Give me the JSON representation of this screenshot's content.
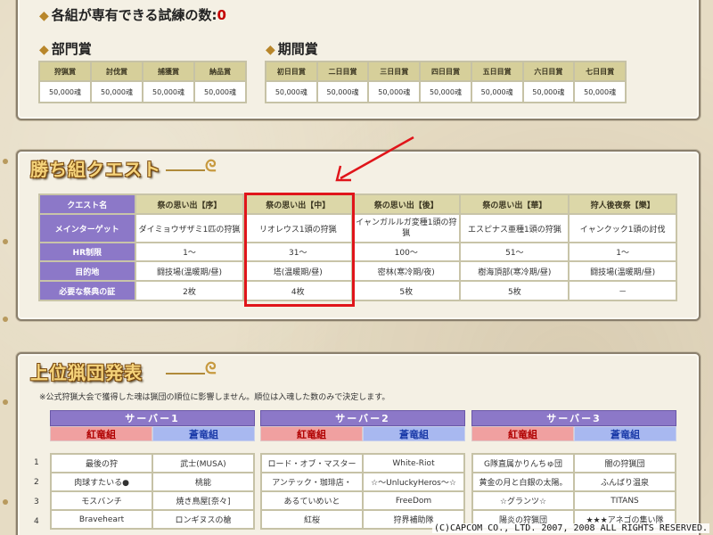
{
  "top": {
    "exclusive_trials_label": "各組が専有できる試練の数:",
    "exclusive_trials_count": "0",
    "dept_prize_title": "部門賞",
    "dept_prize_headers": [
      "狩猟賞",
      "討伐賞",
      "捕獲賞",
      "納品賞"
    ],
    "dept_prize_values": [
      "50,000魂",
      "50,000魂",
      "50,000魂",
      "50,000魂"
    ],
    "period_prize_title": "期間賞",
    "period_prize_headers": [
      "初日目賞",
      "二日目賞",
      "三日目賞",
      "四日目賞",
      "五日目賞",
      "六日目賞",
      "七日目賞"
    ],
    "period_prize_values": [
      "50,000魂",
      "50,000魂",
      "50,000魂",
      "50,000魂",
      "50,000魂",
      "50,000魂",
      "50,000魂"
    ]
  },
  "quest": {
    "banner": "勝ち組クエスト",
    "row_headers": [
      "クエスト名",
      "メインターゲット",
      "HR制限",
      "目的地",
      "必要な祭典の証"
    ],
    "columns": [
      {
        "name": "祭の思い出【序】",
        "target": "ダイミョウザザミ1匹の狩猟",
        "hr": "1～",
        "dest": "闘技場(温暖期/昼)",
        "proof": "2枚"
      },
      {
        "name": "祭の思い出【中】",
        "target": "リオレウス1頭の狩猟",
        "hr": "31～",
        "dest": "塔(温暖期/昼)",
        "proof": "4枚"
      },
      {
        "name": "祭の思い出【後】",
        "target": "イャンガルルガ変種1頭の狩猟",
        "hr": "100～",
        "dest": "密林(寒冷期/夜)",
        "proof": "5枚"
      },
      {
        "name": "祭の思い出【華】",
        "target": "エスピナス亜種1頭の狩猟",
        "hr": "51～",
        "dest": "樹海頂部(寒冷期/昼)",
        "proof": "5枚"
      },
      {
        "name": "狩人後夜祭【樂】",
        "target": "イャンクック1頭の討伐",
        "hr": "1～",
        "dest": "闘技場(温暖期/昼)",
        "proof": "－"
      }
    ]
  },
  "ranking": {
    "banner": "上位猟団発表",
    "note": "※公式狩猟大会で獲得した魂は猟団の順位に影響しません。順位は入魂した数のみで決定します。",
    "rank_numbers": [
      "1",
      "2",
      "3",
      "4"
    ],
    "servers": [
      {
        "name": "サーバー1",
        "red": "紅竜組",
        "blue": "蒼竜組",
        "rows": [
          [
            "最後の狩",
            "武士(MUSA)"
          ],
          [
            "肉球すたいる●",
            "桃能"
          ],
          [
            "モスバンチ",
            "焼き鳥屋[奈々]"
          ],
          [
            "Braveheart",
            "ロンギヌスの槍"
          ]
        ]
      },
      {
        "name": "サーバー2",
        "red": "紅竜組",
        "blue": "蒼竜組",
        "rows": [
          [
            "ロード・オブ・マスター",
            "White-Riot"
          ],
          [
            "アンテック・珈琲店・",
            "☆～UnluckyHeros～☆"
          ],
          [
            "あるていめいと",
            "FreeDom"
          ],
          [
            "紅桜",
            "狩界補助隊"
          ]
        ]
      },
      {
        "name": "サーバー3",
        "red": "紅竜組",
        "blue": "蒼竜組",
        "rows": [
          [
            "G隊直属かりんちゅ団",
            "闇の狩猟団"
          ],
          [
            "黄金の月と白銀の太陽。",
            "ふんばり温泉"
          ],
          [
            "☆グランツ☆",
            "TITANS"
          ],
          [
            "陽炎の狩猟団",
            "★★★アネゴの集い隊"
          ]
        ]
      }
    ]
  },
  "copyright": "(C)CAPCOM CO., LTD. 2007, 2008 ALL RIGHTS RESERVED.",
  "colors": {
    "highlight": "#e0151a",
    "purple": "#8c78c8",
    "red_team": "#f0a0a0",
    "blue_team": "#a8b8f0"
  }
}
